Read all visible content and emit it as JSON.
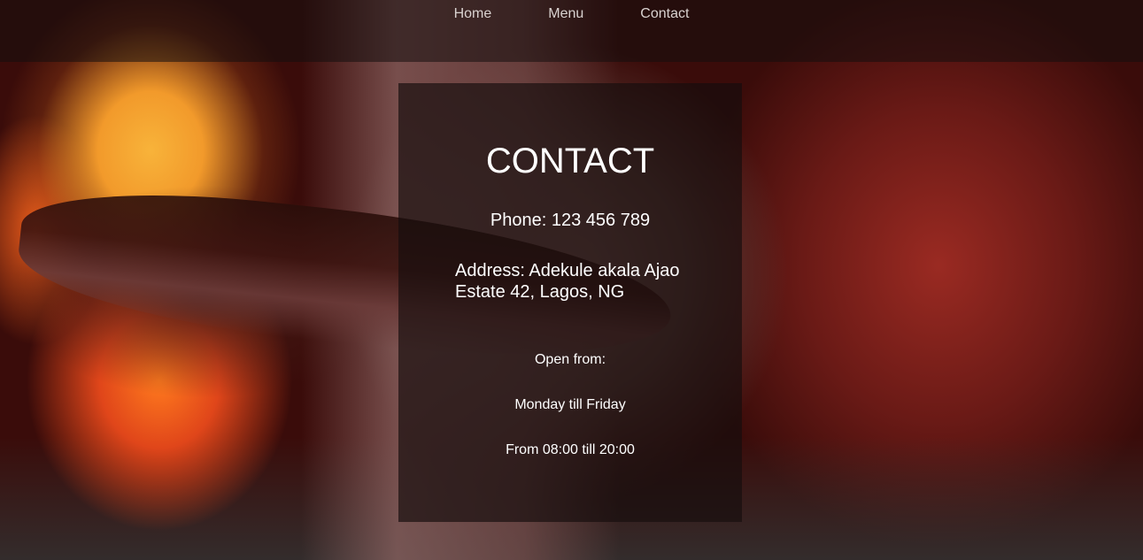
{
  "nav": {
    "items": [
      {
        "label": "Home"
      },
      {
        "label": "Menu"
      },
      {
        "label": "Contact"
      }
    ]
  },
  "contact": {
    "title": "CONTACT",
    "phone": "Phone: 123 456 789",
    "address": "Address: Adekule akala Ajao Estate 42, Lagos, NG",
    "open_from": "Open from:",
    "days": "Monday till Friday",
    "time": "From 08:00 till 20:00"
  }
}
